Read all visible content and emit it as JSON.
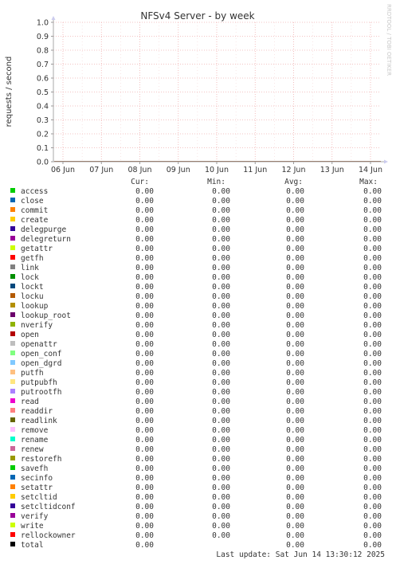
{
  "chart_data": {
    "type": "line",
    "title": "NFSv4 Server - by week",
    "ylabel": "requests / second",
    "watermark": "RRDTOOL / TOBI OETIKER",
    "ylim": [
      0,
      1.0
    ],
    "yticks": [
      "0.0",
      "0.1",
      "0.2",
      "0.3",
      "0.4",
      "0.5",
      "0.6",
      "0.7",
      "0.8",
      "0.9",
      "1.0"
    ],
    "xticks": [
      "06 Jun",
      "07 Jun",
      "08 Jun",
      "09 Jun",
      "10 Jun",
      "11 Jun",
      "12 Jun",
      "13 Jun",
      "14 Jun"
    ],
    "grid": true,
    "legend_headers": [
      "Cur:",
      "Min:",
      "Avg:",
      "Max:"
    ],
    "series": [
      {
        "name": "access",
        "color": "#00cc00",
        "cur": "0.00",
        "min": "0.00",
        "avg": "0.00",
        "max": "0.00"
      },
      {
        "name": "close",
        "color": "#0066b3",
        "cur": "0.00",
        "min": "0.00",
        "avg": "0.00",
        "max": "0.00"
      },
      {
        "name": "commit",
        "color": "#ff8000",
        "cur": "0.00",
        "min": "0.00",
        "avg": "0.00",
        "max": "0.00"
      },
      {
        "name": "create",
        "color": "#ffcc00",
        "cur": "0.00",
        "min": "0.00",
        "avg": "0.00",
        "max": "0.00"
      },
      {
        "name": "delegpurge",
        "color": "#330099",
        "cur": "0.00",
        "min": "0.00",
        "avg": "0.00",
        "max": "0.00"
      },
      {
        "name": "delegreturn",
        "color": "#990099",
        "cur": "0.00",
        "min": "0.00",
        "avg": "0.00",
        "max": "0.00"
      },
      {
        "name": "getattr",
        "color": "#ccff00",
        "cur": "0.00",
        "min": "0.00",
        "avg": "0.00",
        "max": "0.00"
      },
      {
        "name": "getfh",
        "color": "#ff0000",
        "cur": "0.00",
        "min": "0.00",
        "avg": "0.00",
        "max": "0.00"
      },
      {
        "name": "link",
        "color": "#808080",
        "cur": "0.00",
        "min": "0.00",
        "avg": "0.00",
        "max": "0.00"
      },
      {
        "name": "lock",
        "color": "#008f00",
        "cur": "0.00",
        "min": "0.00",
        "avg": "0.00",
        "max": "0.00"
      },
      {
        "name": "lockt",
        "color": "#00487d",
        "cur": "0.00",
        "min": "0.00",
        "avg": "0.00",
        "max": "0.00"
      },
      {
        "name": "locku",
        "color": "#b35a00",
        "cur": "0.00",
        "min": "0.00",
        "avg": "0.00",
        "max": "0.00"
      },
      {
        "name": "lookup",
        "color": "#b38f00",
        "cur": "0.00",
        "min": "0.00",
        "avg": "0.00",
        "max": "0.00"
      },
      {
        "name": "lookup_root",
        "color": "#6b006b",
        "cur": "0.00",
        "min": "0.00",
        "avg": "0.00",
        "max": "0.00"
      },
      {
        "name": "nverify",
        "color": "#8fb300",
        "cur": "0.00",
        "min": "0.00",
        "avg": "0.00",
        "max": "0.00"
      },
      {
        "name": "open",
        "color": "#b30000",
        "cur": "0.00",
        "min": "0.00",
        "avg": "0.00",
        "max": "0.00"
      },
      {
        "name": "openattr",
        "color": "#bebebe",
        "cur": "0.00",
        "min": "0.00",
        "avg": "0.00",
        "max": "0.00"
      },
      {
        "name": "open_conf",
        "color": "#80ff80",
        "cur": "0.00",
        "min": "0.00",
        "avg": "0.00",
        "max": "0.00"
      },
      {
        "name": "open_dgrd",
        "color": "#80c9ff",
        "cur": "0.00",
        "min": "0.00",
        "avg": "0.00",
        "max": "0.00"
      },
      {
        "name": "putfh",
        "color": "#ffc080",
        "cur": "0.00",
        "min": "0.00",
        "avg": "0.00",
        "max": "0.00"
      },
      {
        "name": "putpubfh",
        "color": "#ffe680",
        "cur": "0.00",
        "min": "0.00",
        "avg": "0.00",
        "max": "0.00"
      },
      {
        "name": "putrootfh",
        "color": "#aa80ff",
        "cur": "0.00",
        "min": "0.00",
        "avg": "0.00",
        "max": "0.00"
      },
      {
        "name": "read",
        "color": "#ee00cc",
        "cur": "0.00",
        "min": "0.00",
        "avg": "0.00",
        "max": "0.00"
      },
      {
        "name": "readdir",
        "color": "#ff8080",
        "cur": "0.00",
        "min": "0.00",
        "avg": "0.00",
        "max": "0.00"
      },
      {
        "name": "readlink",
        "color": "#666600",
        "cur": "0.00",
        "min": "0.00",
        "avg": "0.00",
        "max": "0.00"
      },
      {
        "name": "remove",
        "color": "#ffbfff",
        "cur": "0.00",
        "min": "0.00",
        "avg": "0.00",
        "max": "0.00"
      },
      {
        "name": "rename",
        "color": "#00ffcc",
        "cur": "0.00",
        "min": "0.00",
        "avg": "0.00",
        "max": "0.00"
      },
      {
        "name": "renew",
        "color": "#cc6699",
        "cur": "0.00",
        "min": "0.00",
        "avg": "0.00",
        "max": "0.00"
      },
      {
        "name": "restorefh",
        "color": "#999900",
        "cur": "0.00",
        "min": "0.00",
        "avg": "0.00",
        "max": "0.00"
      },
      {
        "name": "savefh",
        "color": "#00cc00",
        "cur": "0.00",
        "min": "0.00",
        "avg": "0.00",
        "max": "0.00"
      },
      {
        "name": "secinfo",
        "color": "#0066b3",
        "cur": "0.00",
        "min": "0.00",
        "avg": "0.00",
        "max": "0.00"
      },
      {
        "name": "setattr",
        "color": "#ff8000",
        "cur": "0.00",
        "min": "0.00",
        "avg": "0.00",
        "max": "0.00"
      },
      {
        "name": "setcltid",
        "color": "#ffcc00",
        "cur": "0.00",
        "min": "0.00",
        "avg": "0.00",
        "max": "0.00"
      },
      {
        "name": "setcltidconf",
        "color": "#330099",
        "cur": "0.00",
        "min": "0.00",
        "avg": "0.00",
        "max": "0.00"
      },
      {
        "name": "verify",
        "color": "#990099",
        "cur": "0.00",
        "min": "0.00",
        "avg": "0.00",
        "max": "0.00"
      },
      {
        "name": "write",
        "color": "#ccff00",
        "cur": "0.00",
        "min": "0.00",
        "avg": "0.00",
        "max": "0.00"
      },
      {
        "name": "rellockowner",
        "color": "#ff0000",
        "cur": "0.00",
        "min": "0.00",
        "avg": "0.00",
        "max": "0.00"
      },
      {
        "name": "total",
        "color": "#000000",
        "cur": "0.00",
        "min": "",
        "avg": "0.00",
        "max": "0.00"
      }
    ],
    "last_update": "Last update: Sat Jun 14 13:30:12 2025"
  }
}
